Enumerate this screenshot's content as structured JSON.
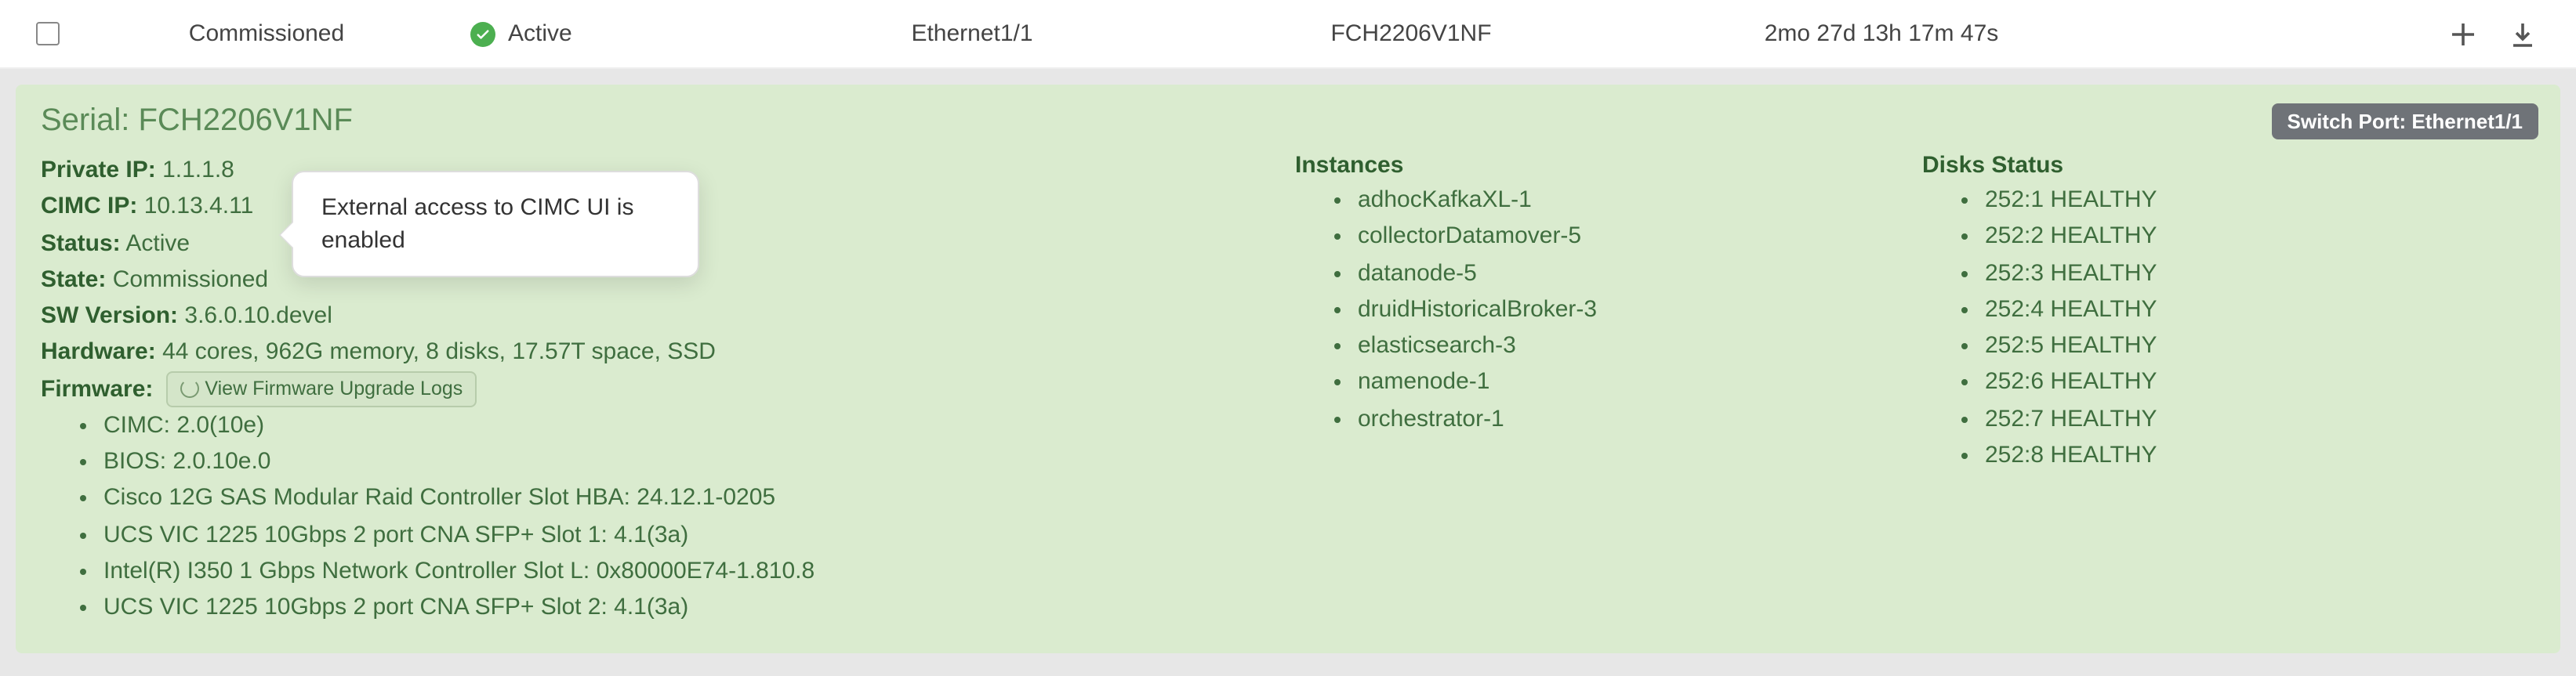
{
  "row": {
    "commissioned": "Commissioned",
    "active_label": "Active",
    "iface": "Ethernet1/1",
    "serial": "FCH2206V1NF",
    "uptime": "2mo 27d 13h 17m 47s"
  },
  "panel": {
    "serial_title": "Serial: FCH2206V1NF",
    "switch_port_badge": "Switch Port: Ethernet1/1",
    "tooltip_text": "External access to CIMC UI is enabled",
    "details": {
      "private_ip": {
        "label": "Private IP:",
        "value": "1.1.1.8"
      },
      "cimc_ip": {
        "label": "CIMC IP:",
        "value": "10.13.4.11"
      },
      "status": {
        "label": "Status:",
        "value": "Active"
      },
      "state": {
        "label": "State:",
        "value": "Commissioned"
      },
      "sw_version": {
        "label": "SW Version:",
        "value": "3.6.0.10.devel"
      },
      "hardware": {
        "label": "Hardware:",
        "value": "44 cores, 962G memory, 8 disks, 17.57T space, SSD"
      },
      "firmware_label": "Firmware:",
      "firmware_button": "View Firmware Upgrade Logs"
    },
    "firmware_items": [
      "CIMC: 2.0(10e)",
      "BIOS: 2.0.10e.0",
      "Cisco 12G SAS Modular Raid Controller Slot HBA: 24.12.1-0205",
      "UCS VIC 1225 10Gbps 2 port CNA SFP+ Slot 1: 4.1(3a)",
      "Intel(R) I350 1 Gbps Network Controller Slot L: 0x80000E74-1.810.8",
      "UCS VIC 1225 10Gbps 2 port CNA SFP+ Slot 2: 4.1(3a)"
    ],
    "instances_heading": "Instances",
    "instances": [
      "adhocKafkaXL-1",
      "collectorDatamover-5",
      "datanode-5",
      "druidHistoricalBroker-3",
      "elasticsearch-3",
      "namenode-1",
      "orchestrator-1"
    ],
    "disks_heading": "Disks Status",
    "disks": [
      "252:1 HEALTHY",
      "252:2 HEALTHY",
      "252:3 HEALTHY",
      "252:4 HEALTHY",
      "252:5 HEALTHY",
      "252:6 HEALTHY",
      "252:7 HEALTHY",
      "252:8 HEALTHY"
    ]
  }
}
